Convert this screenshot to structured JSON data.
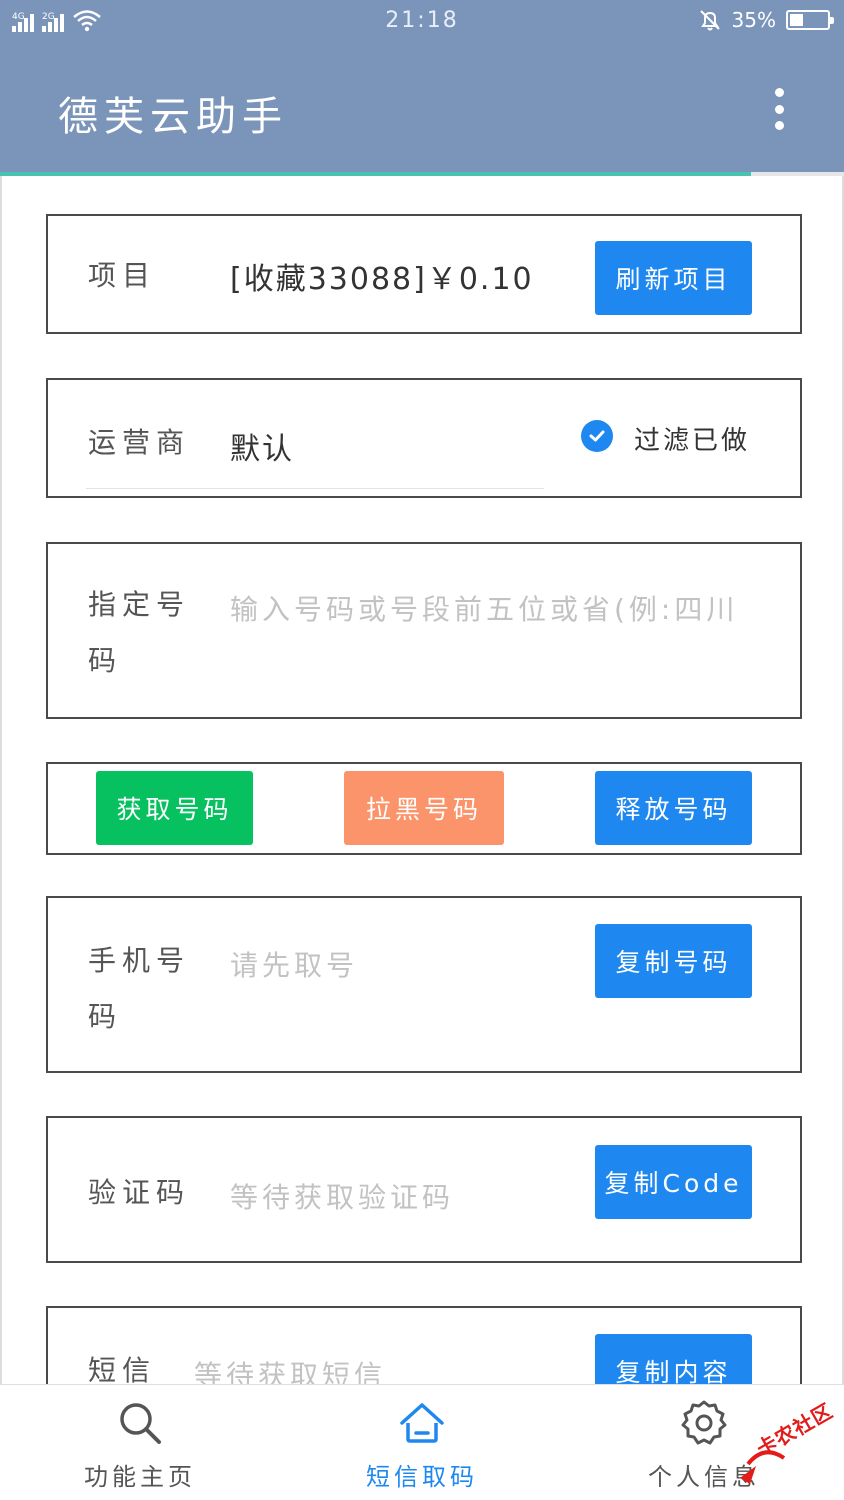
{
  "status_bar": {
    "signal1_label": "4G",
    "signal2_label": "2G",
    "time": "21:18",
    "battery_text": "35%",
    "battery_level": 0.35
  },
  "app_bar": {
    "title": "德芙云助手",
    "more_icon": "more-vert-icon",
    "loading_progress": 0.89
  },
  "project": {
    "label": "项目",
    "value": "[收藏33088]￥0.10",
    "refresh_label": "刷新项目"
  },
  "carrier": {
    "label": "运营商",
    "value": "默认",
    "filter_label": "过滤已做",
    "filter_checked": true
  },
  "designated_number": {
    "label_line1": "指定号",
    "label_line2": "码",
    "placeholder": "输入号码或号段前五位或省(例:四川"
  },
  "number_actions": {
    "get_label": "获取号码",
    "block_label": "拉黑号码",
    "release_label": "释放号码"
  },
  "phone_number": {
    "label_line1": "手机号",
    "label_line2": "码",
    "placeholder": "请先取号",
    "copy_label": "复制号码"
  },
  "verification": {
    "label": "验证码",
    "placeholder": "等待获取验证码",
    "copy_label": "复制Code"
  },
  "sms": {
    "label": "短信",
    "placeholder": "等待获取短信",
    "copy_label": "复制内容"
  },
  "bottom_nav": {
    "items": [
      {
        "label": "功能主页",
        "icon": "search-icon",
        "active": false
      },
      {
        "label": "短信取码",
        "icon": "home-icon",
        "active": true
      },
      {
        "label": "个人信息",
        "icon": "gear-icon",
        "active": false
      }
    ]
  },
  "watermark": {
    "text": "卡农社区"
  },
  "colors": {
    "primary": "#7b95ba",
    "button_blue": "#1e88f0",
    "button_green": "#07c160",
    "button_orange": "#fb946a",
    "placeholder": "#c2c2c2",
    "nav_active": "#1e88f0"
  }
}
